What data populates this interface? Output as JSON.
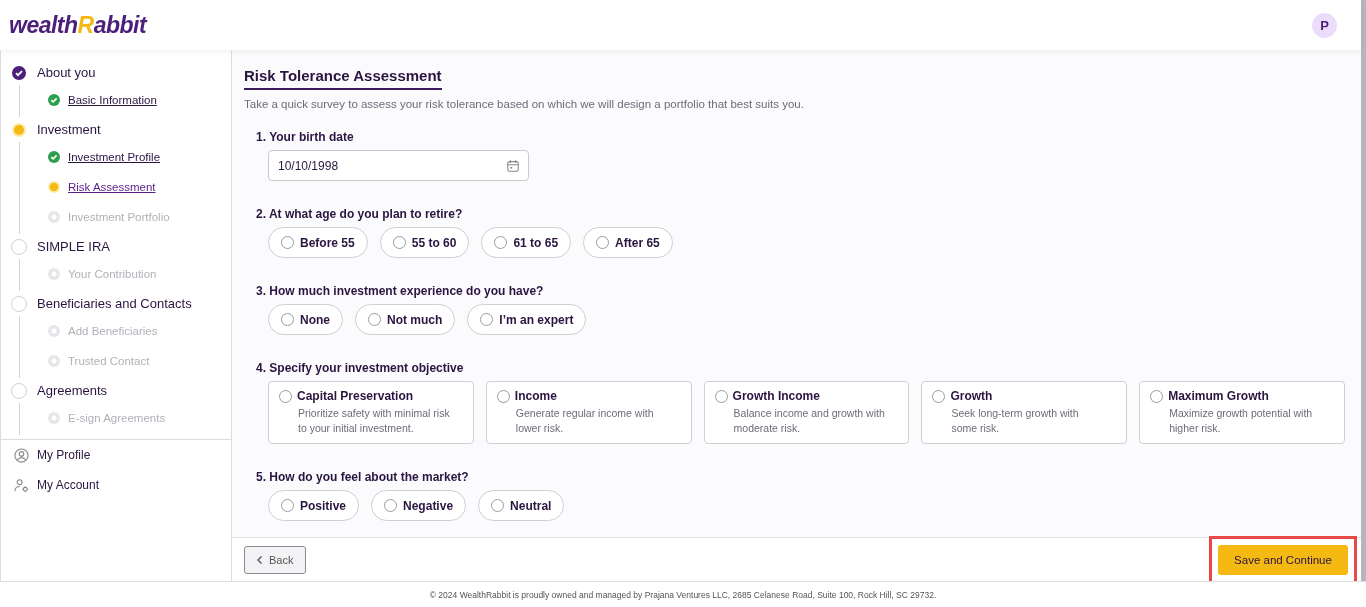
{
  "header": {
    "logo": [
      "wealth",
      "R",
      "abbit"
    ],
    "avatar": "P"
  },
  "sidebar": {
    "steps": [
      {
        "label": "About you",
        "completed": true,
        "active": false,
        "children": [
          {
            "label": "Basic Information",
            "completed": true,
            "active": false
          }
        ]
      },
      {
        "label": "Investment",
        "completed": false,
        "active": true,
        "children": [
          {
            "label": "Investment Profile",
            "completed": true,
            "active": false
          },
          {
            "label": "Risk Assessment",
            "completed": false,
            "active": true
          },
          {
            "label": "Investment Portfolio",
            "completed": false,
            "active": false
          }
        ]
      },
      {
        "label": "SIMPLE IRA",
        "completed": false,
        "active": false,
        "children": [
          {
            "label": "Your Contribution",
            "completed": false,
            "active": false
          }
        ]
      },
      {
        "label": "Beneficiaries and Contacts",
        "completed": false,
        "active": false,
        "children": [
          {
            "label": "Add Beneficiaries",
            "completed": false,
            "active": false
          },
          {
            "label": "Trusted Contact",
            "completed": false,
            "active": false
          }
        ]
      },
      {
        "label": "Agreements",
        "completed": false,
        "active": false,
        "children": [
          {
            "label": "E-sign Agreements",
            "completed": false,
            "active": false
          }
        ]
      }
    ],
    "links": [
      {
        "label": "My Profile",
        "kind": "profile"
      },
      {
        "label": "My Account",
        "kind": "account"
      }
    ]
  },
  "page": {
    "title": "Risk Tolerance Assessment",
    "subtitle": "Take a quick survey to assess your risk tolerance based on which we will design a portfolio that best suits you.",
    "questions": [
      {
        "kind": "date",
        "label": "1. Your birth date",
        "value": "10/10/1998"
      },
      {
        "kind": "pills",
        "label": "2. At what age do you plan to retire?",
        "options": [
          {
            "label": "Before 55",
            "selected": false
          },
          {
            "label": "55 to 60",
            "selected": false
          },
          {
            "label": "61 to 65",
            "selected": false
          },
          {
            "label": "After 65",
            "selected": false
          }
        ]
      },
      {
        "kind": "pills",
        "label": "3. How much investment experience do you have?",
        "options": [
          {
            "label": "None",
            "selected": false
          },
          {
            "label": "Not much",
            "selected": false
          },
          {
            "label": "I’m an expert",
            "selected": false
          }
        ]
      },
      {
        "kind": "cards",
        "label": "4. Specify your investment objective",
        "options": [
          {
            "label": "Capital Preservation",
            "description": "Prioritize safety with minimal risk to your initial investment.",
            "selected": false
          },
          {
            "label": "Income",
            "description": "Generate regular income with lower risk.",
            "selected": false
          },
          {
            "label": "Growth Income",
            "description": "Balance income and growth with moderate risk.",
            "selected": false
          },
          {
            "label": "Growth",
            "description": "Seek long-term growth with some risk.",
            "selected": false
          },
          {
            "label": "Maximum Growth",
            "description": "Maximize growth potential with higher risk.",
            "selected": false
          }
        ]
      },
      {
        "kind": "pills",
        "label": "5. How do you feel about the market?",
        "options": [
          {
            "label": "Positive",
            "selected": false
          },
          {
            "label": "Negative",
            "selected": false
          },
          {
            "label": "Neutral",
            "selected": false
          }
        ]
      }
    ]
  },
  "actions": {
    "back": "Back",
    "save": "Save and Continue",
    "save_highlighted": true
  },
  "footer": "© 2024 WealthRabbit is proudly owned and managed by Prajana Ventures LLC, 2685 Celanese Road, Suite 100, Rock Hill, SC 29732."
}
